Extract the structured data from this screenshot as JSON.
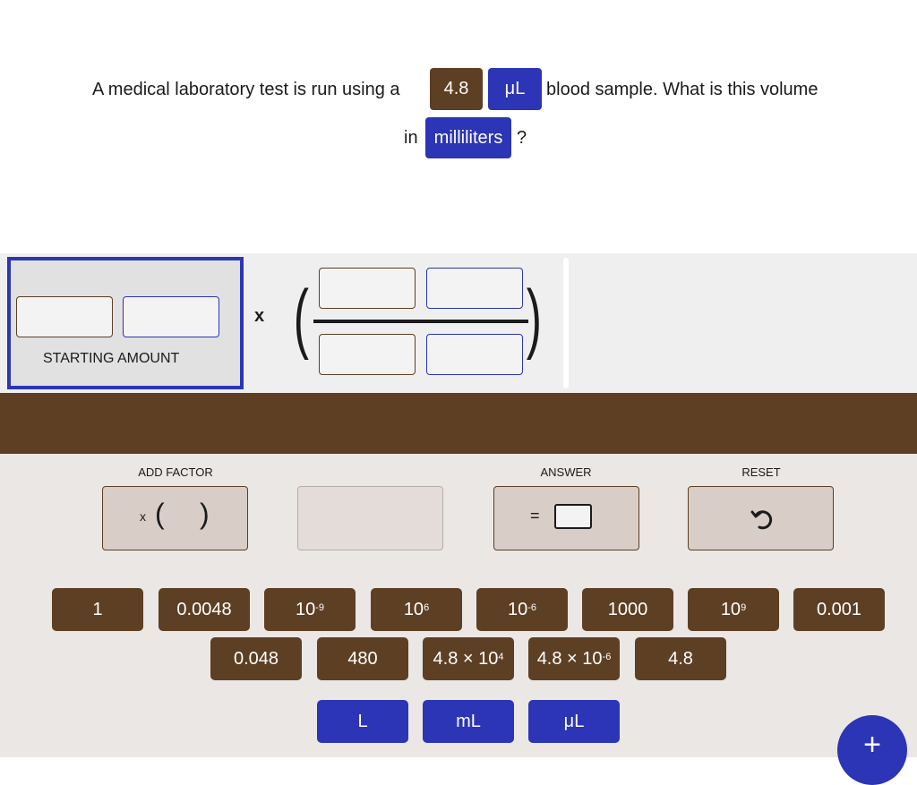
{
  "question": {
    "part1": "A medical laboratory test is run using a",
    "value_chip": "4.8",
    "unit_chip": "μL",
    "part2": "blood sample. What is this volume",
    "part3": "in",
    "target_unit_chip": "milliliters",
    "part4": "?"
  },
  "workspace": {
    "starting_amount_label": "STARTING AMOUNT",
    "times_symbol": "x",
    "open_paren": "(",
    "close_paren": ")"
  },
  "controls": {
    "add_factor_label": "ADD FACTOR",
    "add_factor_button": {
      "times": "x",
      "open": "(",
      "close": ")"
    },
    "answer_label": "ANSWER",
    "answer_equals": "=",
    "reset_label": "RESET"
  },
  "tiles": {
    "row1": [
      {
        "base": "1",
        "exp": ""
      },
      {
        "base": "0.0048",
        "exp": ""
      },
      {
        "base": "10",
        "exp": "-9"
      },
      {
        "base": "10",
        "exp": "6"
      },
      {
        "base": "10",
        "exp": "-6"
      },
      {
        "base": "1000",
        "exp": ""
      },
      {
        "base": "10",
        "exp": "9"
      },
      {
        "base": "0.001",
        "exp": ""
      }
    ],
    "row2": [
      {
        "base": "0.048",
        "exp": ""
      },
      {
        "base": "480",
        "exp": ""
      },
      {
        "base": "4.8 × 10",
        "exp": "4"
      },
      {
        "base": "4.8 × 10",
        "exp": "-6"
      },
      {
        "base": "4.8",
        "exp": ""
      }
    ],
    "units": [
      "L",
      "mL",
      "μL"
    ]
  },
  "fab": {
    "label": "+"
  },
  "colors": {
    "brown": "#5d3f23",
    "blue": "#2c35b5",
    "band": "#5e3f24"
  }
}
